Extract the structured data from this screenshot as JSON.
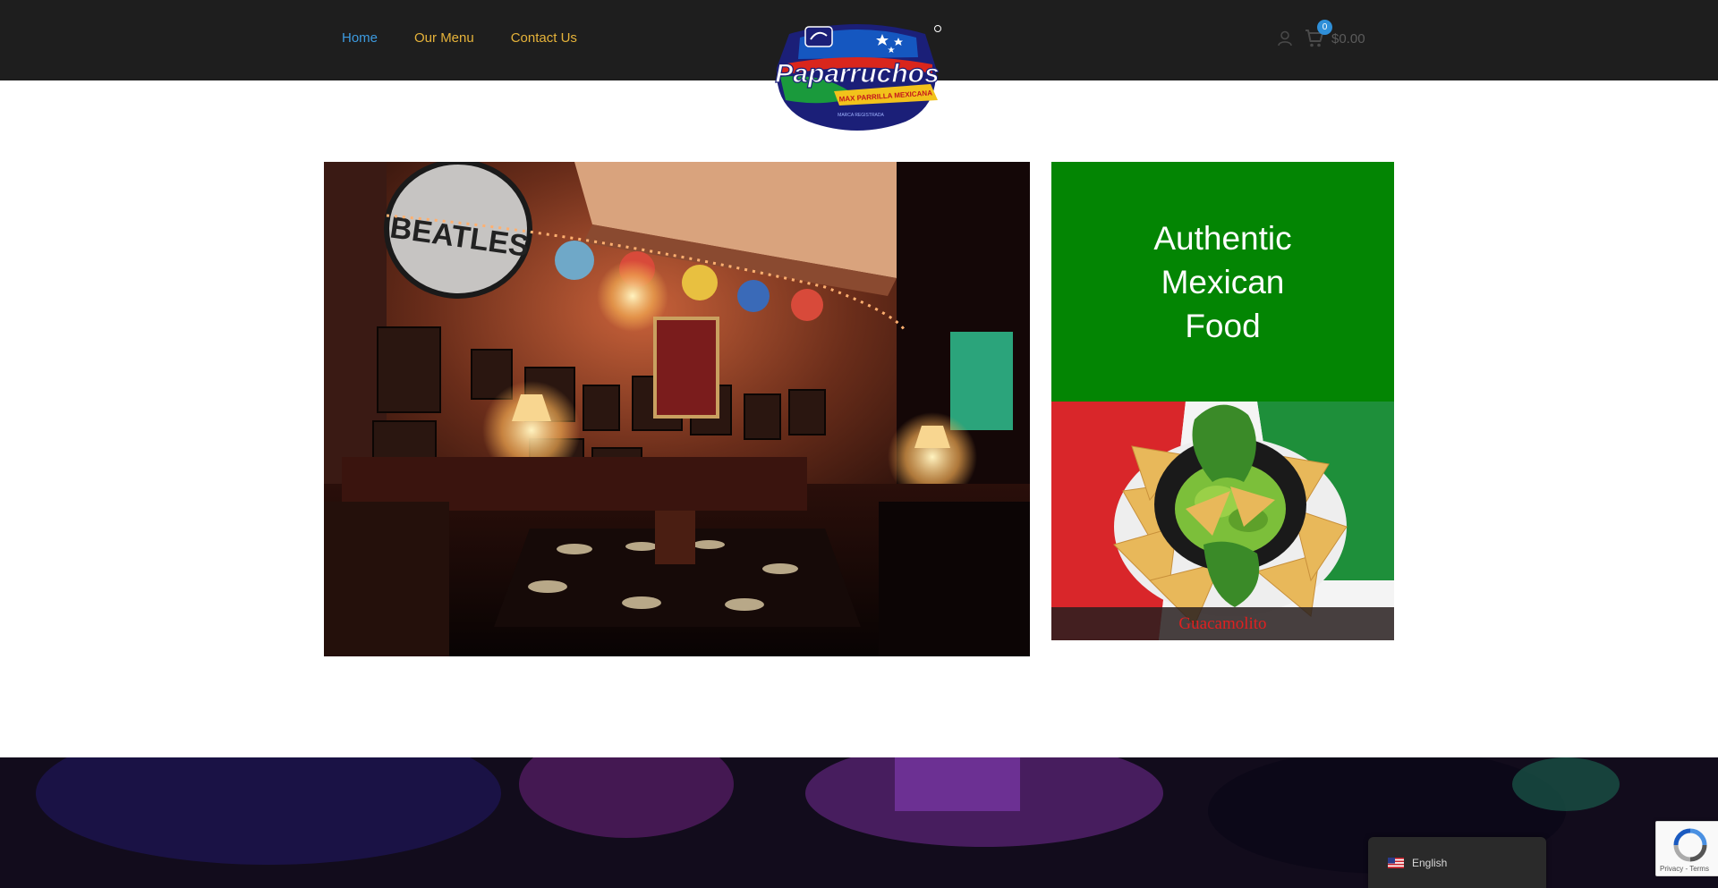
{
  "nav": {
    "items": [
      {
        "label": "Home",
        "active": true
      },
      {
        "label": "Our Menu",
        "active": false
      },
      {
        "label": "Contact Us",
        "active": false
      }
    ]
  },
  "logo": {
    "brand": "Paparruchos",
    "tagline": "MAX PARRILLA MEXICANA",
    "sub": "MARCA REGISTRADA"
  },
  "cart": {
    "count": "0",
    "total": "$0.00"
  },
  "hero": {
    "sign_text": "BEATLES"
  },
  "promo": {
    "title": "Authentic Mexican Food"
  },
  "dish": {
    "caption": "Guacamolito"
  },
  "language": {
    "current": "English"
  },
  "recaptcha": {
    "text": "Privacy - Terms"
  },
  "colors": {
    "header_bg": "#1e1e1e",
    "nav_link": "#e6b33a",
    "nav_active": "#3d9be0",
    "promo_bg": "#038503",
    "caption": "#e02020",
    "badge": "#2f8fd8"
  },
  "icons": [
    "user-icon",
    "cart-icon",
    "us-flag-icon",
    "recaptcha-icon"
  ]
}
